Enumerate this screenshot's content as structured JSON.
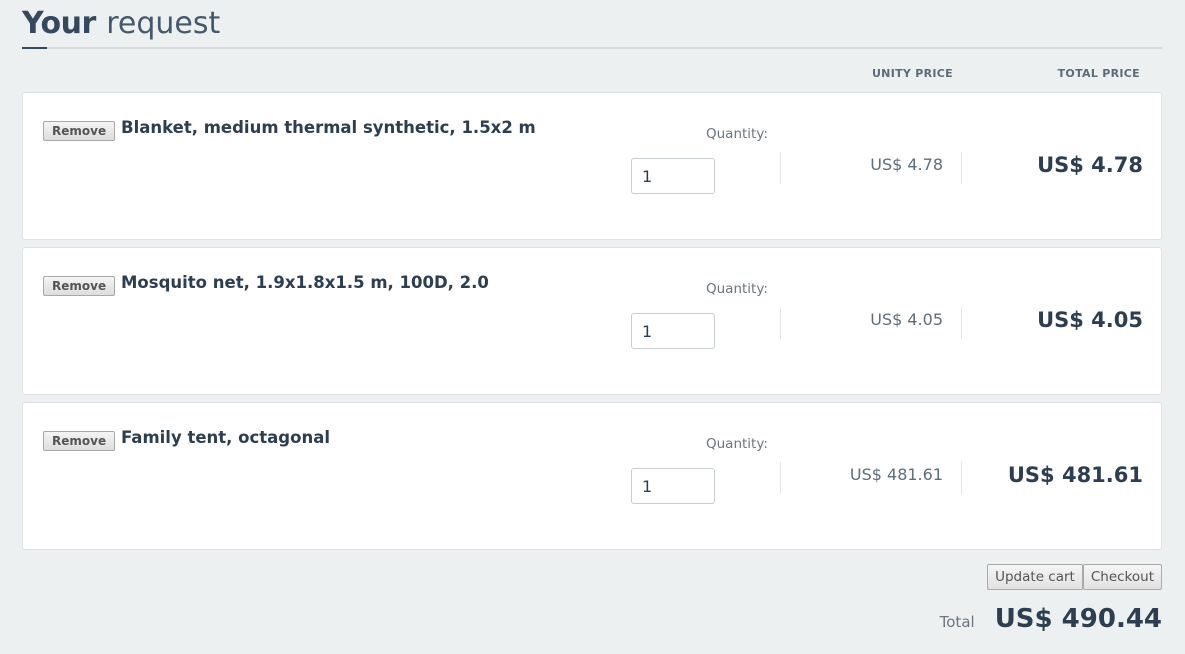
{
  "page": {
    "title_bold": "Your",
    "title_light": "request"
  },
  "columns": {
    "unit_price": "UNITY PRICE",
    "total_price": "TOTAL PRICE"
  },
  "items": [
    {
      "remove_label": "Remove",
      "name": "Blanket, medium thermal synthetic, 1.5x2 m",
      "quantity_label": "Quantity:",
      "quantity": "1",
      "unit_price": "US$ 4.78",
      "total_price": "US$ 4.78"
    },
    {
      "remove_label": "Remove",
      "name": "Mosquito net, 1.9x1.8x1.5 m, 100D, 2.0",
      "quantity_label": "Quantity:",
      "quantity": "1",
      "unit_price": "US$ 4.05",
      "total_price": "US$ 4.05"
    },
    {
      "remove_label": "Remove",
      "name": "Family tent, octagonal",
      "quantity_label": "Quantity:",
      "quantity": "1",
      "unit_price": "US$ 481.61",
      "total_price": "US$ 481.61"
    }
  ],
  "actions": {
    "update_label": "Update cart",
    "checkout_label": "Checkout"
  },
  "summary": {
    "total_label": "Total",
    "total_value": "US$ 490.44"
  },
  "colors": {
    "background": "#edf0f1",
    "text_dark": "#2c3e50",
    "card": "#ffffff"
  }
}
